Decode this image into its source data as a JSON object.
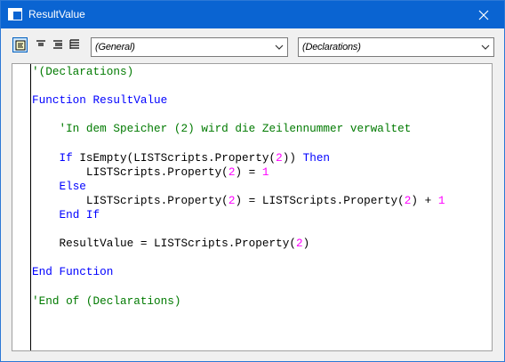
{
  "window": {
    "title": "ResultValue"
  },
  "toolbar": {
    "buttons": [
      {
        "icon": "procedure-view-icon",
        "pressed": true
      },
      {
        "icon": "align-top-icon",
        "pressed": false
      },
      {
        "icon": "align-center-icon",
        "pressed": false
      },
      {
        "icon": "full-module-view-icon",
        "pressed": false
      }
    ],
    "object_combo": "(General)",
    "proc_combo": "(Declarations)"
  },
  "colors": {
    "keyword": "#0000ff",
    "comment": "#007a00",
    "number": "#ff00ff",
    "titlebar": "#0a64d2"
  },
  "code": {
    "lines": [
      [
        {
          "t": "'(Declarations)",
          "c": "cm"
        }
      ],
      [],
      [
        {
          "t": "Function",
          "c": "kw"
        },
        {
          "t": " ResultValue",
          "c": "kw"
        }
      ],
      [],
      [
        {
          "t": "    'In dem Speicher (2) wird die Zeilennummer verwaltet",
          "c": "cm"
        }
      ],
      [],
      [
        {
          "t": "    ",
          "c": "tx"
        },
        {
          "t": "If",
          "c": "kw"
        },
        {
          "t": " IsEmpty(LISTScripts.Property(",
          "c": "tx"
        },
        {
          "t": "2",
          "c": "num"
        },
        {
          "t": ")) ",
          "c": "tx"
        },
        {
          "t": "Then",
          "c": "kw"
        }
      ],
      [
        {
          "t": "        LISTScripts.Property(",
          "c": "tx"
        },
        {
          "t": "2",
          "c": "num"
        },
        {
          "t": ") = ",
          "c": "tx"
        },
        {
          "t": "1",
          "c": "num"
        }
      ],
      [
        {
          "t": "    ",
          "c": "tx"
        },
        {
          "t": "Else",
          "c": "kw"
        }
      ],
      [
        {
          "t": "        LISTScripts.Property(",
          "c": "tx"
        },
        {
          "t": "2",
          "c": "num"
        },
        {
          "t": ") = LISTScripts.Property(",
          "c": "tx"
        },
        {
          "t": "2",
          "c": "num"
        },
        {
          "t": ") + ",
          "c": "tx"
        },
        {
          "t": "1",
          "c": "num"
        }
      ],
      [
        {
          "t": "    ",
          "c": "tx"
        },
        {
          "t": "End If",
          "c": "kw"
        }
      ],
      [],
      [
        {
          "t": "    ResultValue = LISTScripts.Property(",
          "c": "tx"
        },
        {
          "t": "2",
          "c": "num"
        },
        {
          "t": ")",
          "c": "tx"
        }
      ],
      [],
      [
        {
          "t": "End Function",
          "c": "kw"
        }
      ],
      [],
      [
        {
          "t": "'End of (Declarations)",
          "c": "cm"
        }
      ]
    ]
  }
}
